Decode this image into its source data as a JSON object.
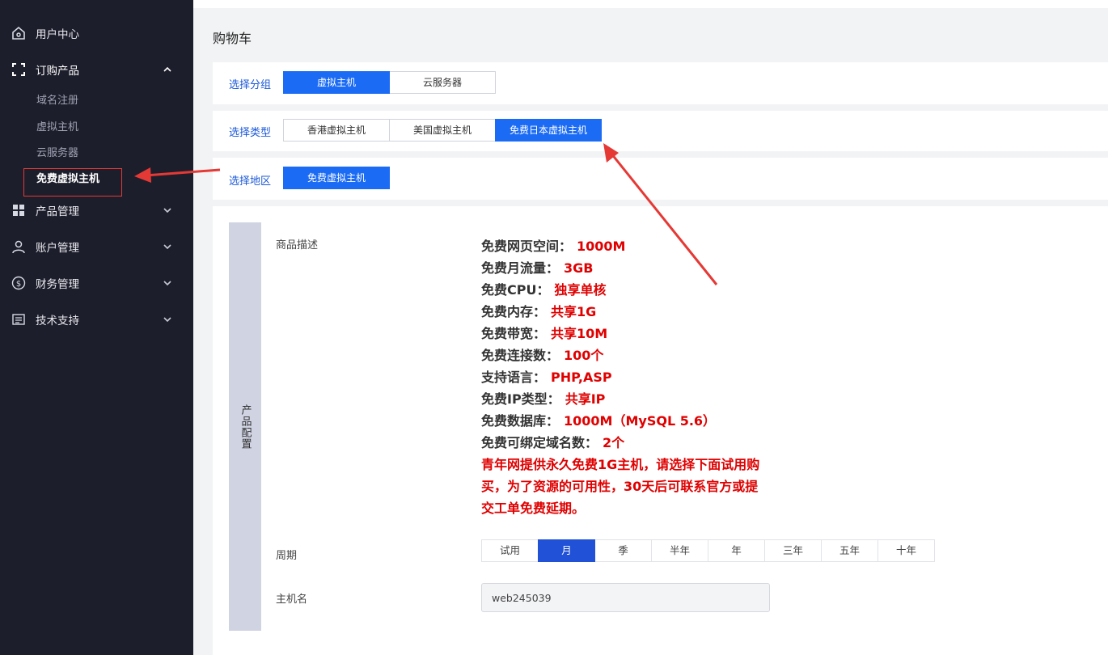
{
  "sidebar": {
    "items": [
      {
        "label": "用户中心",
        "icon": "home-icon"
      },
      {
        "label": "订购产品",
        "icon": "bracket-icon",
        "expanded": true
      },
      {
        "label": "产品管理",
        "icon": "grid-icon"
      },
      {
        "label": "账户管理",
        "icon": "user-icon"
      },
      {
        "label": "财务管理",
        "icon": "dollar-icon"
      },
      {
        "label": "技术支持",
        "icon": "document-icon"
      }
    ],
    "sub_items": [
      "域名注册",
      "虚拟主机",
      "云服务器",
      "免费虚拟主机"
    ],
    "active_sub": "免费虚拟主机"
  },
  "page": {
    "title": "购物车"
  },
  "group": {
    "label": "选择分组",
    "options": [
      "虚拟主机",
      "云服务器"
    ],
    "selected": "虚拟主机"
  },
  "type": {
    "label": "选择类型",
    "options": [
      "香港虚拟主机",
      "美国虚拟主机",
      "免费日本虚拟主机"
    ],
    "selected": "免费日本虚拟主机"
  },
  "region": {
    "label": "选择地区",
    "options": [
      "免费虚拟主机"
    ],
    "selected": "免费虚拟主机"
  },
  "config": {
    "tab_label": "产品配置",
    "desc_label": "商品描述",
    "description": [
      {
        "key": "免费网页空间：",
        "value": "1000M"
      },
      {
        "key": "免费月流量：",
        "value": "3GB"
      },
      {
        "key": "免费CPU：",
        "value": "独享单核"
      },
      {
        "key": "免费内存：",
        "value": "共享1G"
      },
      {
        "key": "免费带宽：",
        "value": "共享10M"
      },
      {
        "key": "免费连接数：",
        "value": "100个"
      },
      {
        "key": "支持语言：",
        "value": "PHP,ASP"
      },
      {
        "key": "免费IP类型：",
        "value": "共享IP"
      },
      {
        "key": "免费数据库：",
        "value": "1000M（MySQL 5.6）"
      },
      {
        "key": "免费可绑定域名数：",
        "value": "2个"
      }
    ],
    "notice": "青年网提供永久免费1G主机，请选择下面试用购买，为了资源的可用性，30天后可联系官方或提交工单免费延期。",
    "period_label": "周期",
    "periods": [
      "试用",
      "月",
      "季",
      "半年",
      "年",
      "三年",
      "五年",
      "十年"
    ],
    "period_selected": "月",
    "hostname_label": "主机名",
    "hostname_value": "web245039"
  },
  "colors": {
    "sidebar_bg": "#1d1e2b",
    "accent": "#1b6bf5",
    "period_active": "#2151d6",
    "highlight_red": "#e00000",
    "annotation_red": "#e53935"
  }
}
